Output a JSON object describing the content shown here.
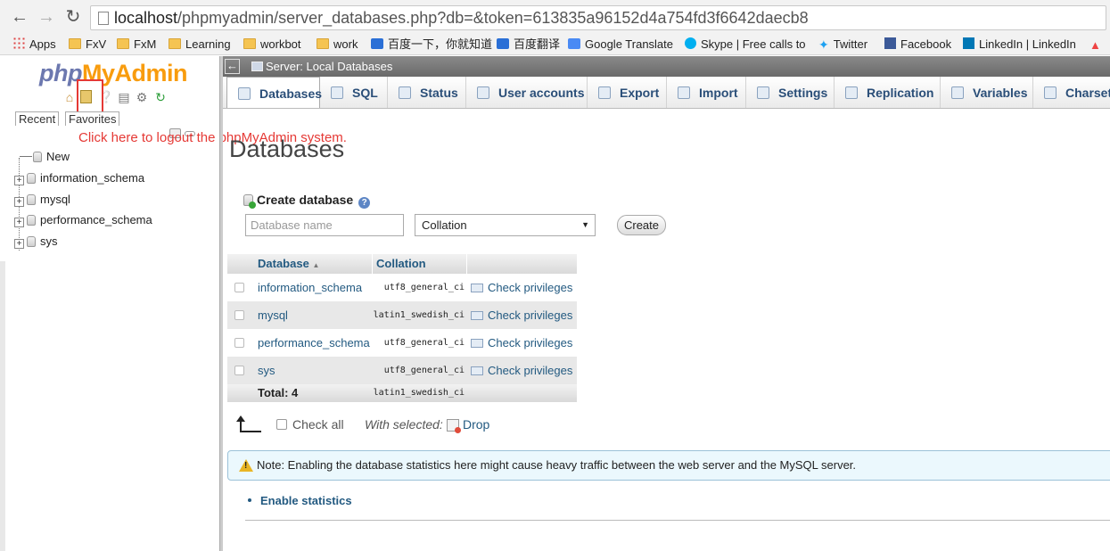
{
  "browser": {
    "url_host": "localhost",
    "url_rest": "/phpmyadmin/server_databases.php?db=&token=613835a96152d4a754fd3f6642daecb8",
    "bookmarks": [
      {
        "label": "Apps",
        "icon": "apps-icon"
      },
      {
        "label": "FxV",
        "icon": "folder-icon"
      },
      {
        "label": "FxM",
        "icon": "folder-icon"
      },
      {
        "label": "Learning",
        "icon": "folder-icon"
      },
      {
        "label": "workbot",
        "icon": "folder-icon"
      },
      {
        "label": "work",
        "icon": "folder-icon"
      },
      {
        "label": "百度一下，你就知道",
        "icon": "baidu-icon"
      },
      {
        "label": "百度翻译",
        "icon": "baidu-translate-icon"
      },
      {
        "label": "Google Translate",
        "icon": "google-translate-icon"
      },
      {
        "label": "Skype | Free calls to",
        "icon": "skype-icon"
      },
      {
        "label": "Twitter",
        "icon": "twitter-icon"
      },
      {
        "label": "Facebook",
        "icon": "facebook-icon"
      },
      {
        "label": "LinkedIn | LinkedIn",
        "icon": "linkedin-icon"
      }
    ]
  },
  "sidebar": {
    "logo_php": "php",
    "logo_my": "My",
    "logo_admin": "Admin",
    "tabs": [
      "Recent",
      "Favorites"
    ],
    "annotation": "Click here to logout the phpMyAdmin system.",
    "tree": [
      {
        "label": "New",
        "expandable": false
      },
      {
        "label": "information_schema",
        "expandable": true
      },
      {
        "label": "mysql",
        "expandable": true
      },
      {
        "label": "performance_schema",
        "expandable": true
      },
      {
        "label": "sys",
        "expandable": true
      }
    ]
  },
  "topbar": {
    "breadcrumb": "Server: Local Databases"
  },
  "tabs": [
    {
      "label": "Databases",
      "active": true
    },
    {
      "label": "SQL"
    },
    {
      "label": "Status"
    },
    {
      "label": "User accounts"
    },
    {
      "label": "Export"
    },
    {
      "label": "Import"
    },
    {
      "label": "Settings"
    },
    {
      "label": "Replication"
    },
    {
      "label": "Variables"
    },
    {
      "label": "Charset"
    }
  ],
  "main": {
    "title": "Databases",
    "create": {
      "heading": "Create database",
      "name_placeholder": "Database name",
      "collation_value": "Collation",
      "button": "Create"
    },
    "table": {
      "headers": {
        "database": "Database",
        "collation": "Collation"
      },
      "rows": [
        {
          "name": "information_schema",
          "collation": "utf8_general_ci",
          "action": "Check privileges"
        },
        {
          "name": "mysql",
          "collation": "latin1_swedish_ci",
          "action": "Check privileges"
        },
        {
          "name": "performance_schema",
          "collation": "utf8_general_ci",
          "action": "Check privileges"
        },
        {
          "name": "sys",
          "collation": "utf8_general_ci",
          "action": "Check privileges"
        }
      ],
      "total_label": "Total: 4",
      "total_collation": "latin1_swedish_ci"
    },
    "check_all": "Check all",
    "with_selected": "With selected:",
    "drop": "Drop",
    "notice": "Note: Enabling the database statistics here might cause heavy traffic between the web server and the MySQL server.",
    "enable_stats": "Enable statistics"
  }
}
